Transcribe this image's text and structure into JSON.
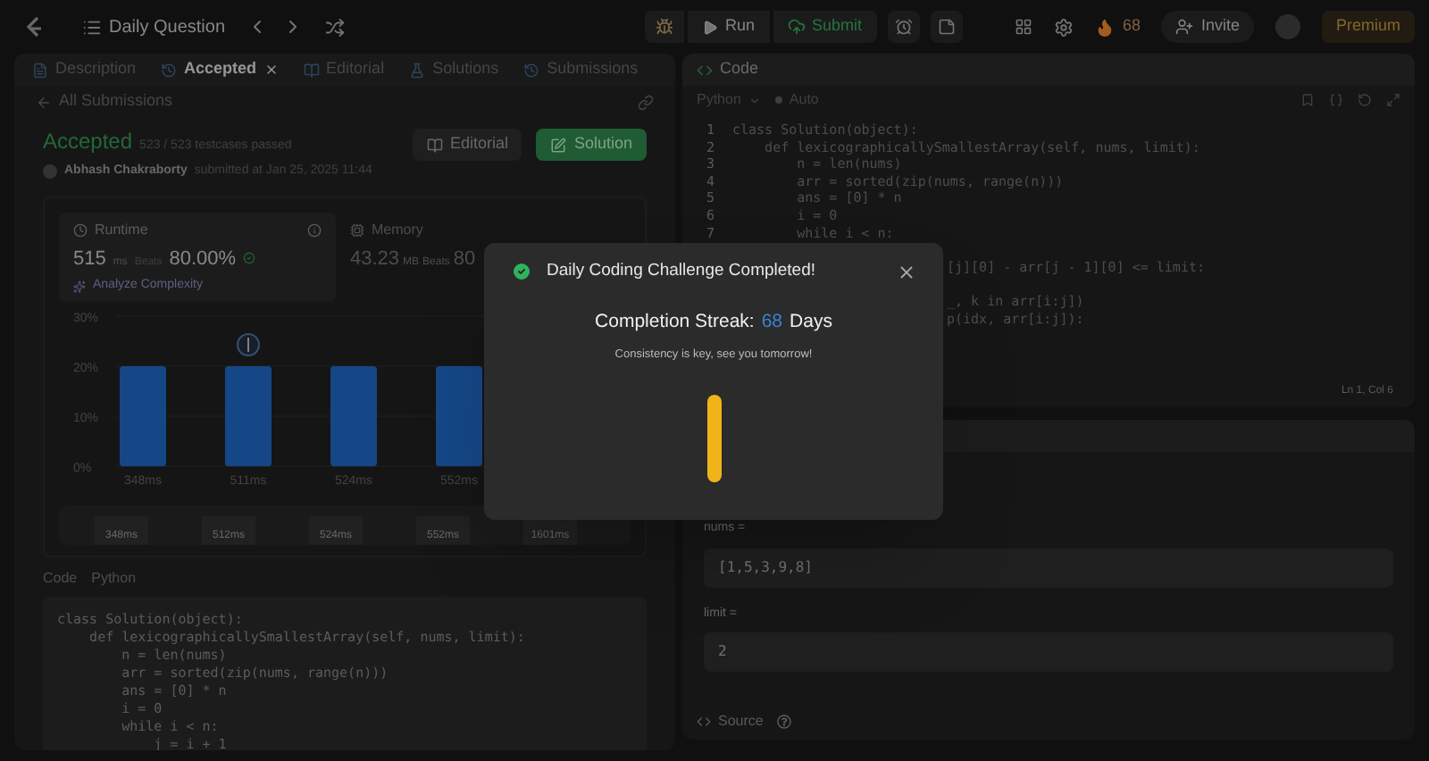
{
  "topbar": {
    "title": "Daily Question",
    "run": "Run",
    "submit": "Submit",
    "streak": "68",
    "invite": "Invite",
    "premium": "Premium"
  },
  "left_panel": {
    "tabs": [
      {
        "label": "Description",
        "selected": false,
        "closable": false
      },
      {
        "label": "Accepted",
        "selected": true,
        "closable": true
      },
      {
        "label": "Editorial",
        "selected": false,
        "closable": false
      },
      {
        "label": "Solutions",
        "selected": false,
        "closable": false
      },
      {
        "label": "Submissions",
        "selected": false,
        "closable": false
      }
    ],
    "back_link": "All Submissions",
    "status": "Accepted",
    "testcases": "523 / 523 testcases passed",
    "author": "Abhash Chakraborty",
    "submitted": "submitted at Jan 25, 2025 11:44",
    "buttons": [
      {
        "label": "Editorial",
        "kind": "secondary"
      },
      {
        "label": "Solution",
        "kind": "primary"
      }
    ],
    "runtime": {
      "title": "Runtime",
      "value": "515",
      "unit": "ms",
      "beats_label": "Beats",
      "beats": "80.00%",
      "analyze": "Analyze Complexity"
    },
    "memory": {
      "title": "Memory",
      "value": "43.23",
      "unit": "MB",
      "beats_label": "Beats",
      "beats": "80"
    },
    "chart_data": {
      "type": "bar",
      "categories": [
        "348ms",
        "511ms",
        "524ms",
        "552ms"
      ],
      "series": [
        {
          "color": "#1d5fb4",
          "values": [
            20,
            20,
            20,
            20
          ]
        }
      ],
      "ylim": [
        0,
        30
      ],
      "yticks": [
        {
          "value": 0,
          "label": "0%"
        },
        {
          "value": 10,
          "label": "10%"
        },
        {
          "value": 20,
          "label": "20%"
        },
        {
          "value": 30,
          "label": "30%"
        }
      ]
    },
    "overview_labels": [
      "348ms",
      "512ms",
      "524ms",
      "552ms",
      "1601ms"
    ],
    "code_label": "Code",
    "language": "Python",
    "code": [
      "class Solution(object):",
      "    def lexicographicallySmallestArray(self, nums, limit):",
      "        n = len(nums)",
      "        arr = sorted(zip(nums, range(n)))",
      "        ans = [0] * n",
      "        i = 0",
      "        while i < n:",
      "            j = i + 1"
    ]
  },
  "editor": {
    "title": "Code",
    "language": "Python",
    "mode": "Auto",
    "lines": [
      {
        "kind": "full",
        "number": "1",
        "text": "class Solution(object):"
      },
      {
        "kind": "full",
        "number": "2",
        "text": "    def lexicographicallySmallestArray(self, nums, limit):"
      },
      {
        "kind": "full",
        "number": "3",
        "text": "        n = len(nums)"
      },
      {
        "kind": "full",
        "number": "4",
        "text": "        arr = sorted(zip(nums, range(n)))"
      },
      {
        "kind": "full",
        "number": "5",
        "text": "        ans = [0] * n"
      },
      {
        "kind": "full",
        "number": "6",
        "text": "        i = 0"
      },
      {
        "kind": "full",
        "number": "7",
        "text": "        while i < n:"
      },
      {
        "kind": "covered"
      },
      {
        "kind": "fragment",
        "text": "[j][0] - arr[j - 1][0] <= limit:"
      },
      {
        "kind": "covered"
      },
      {
        "kind": "fragment",
        "text": "_, k in arr[i:j])"
      },
      {
        "kind": "fragment",
        "text": "p(idx, arr[i:j]):"
      }
    ],
    "cursor": "Ln 1, Col 6"
  },
  "testcase": {
    "fields": [
      {
        "label": "nums =",
        "value": "[1,5,3,9,8]"
      },
      {
        "label": "limit =",
        "value": "2"
      }
    ],
    "source": "Source"
  },
  "modal": {
    "title": "Daily Coding Challenge Completed!",
    "streak_label": "Completion Streak:",
    "streak_count": "68",
    "streak_unit": "Days",
    "message": "Consistency is key, see you tomorrow!"
  }
}
